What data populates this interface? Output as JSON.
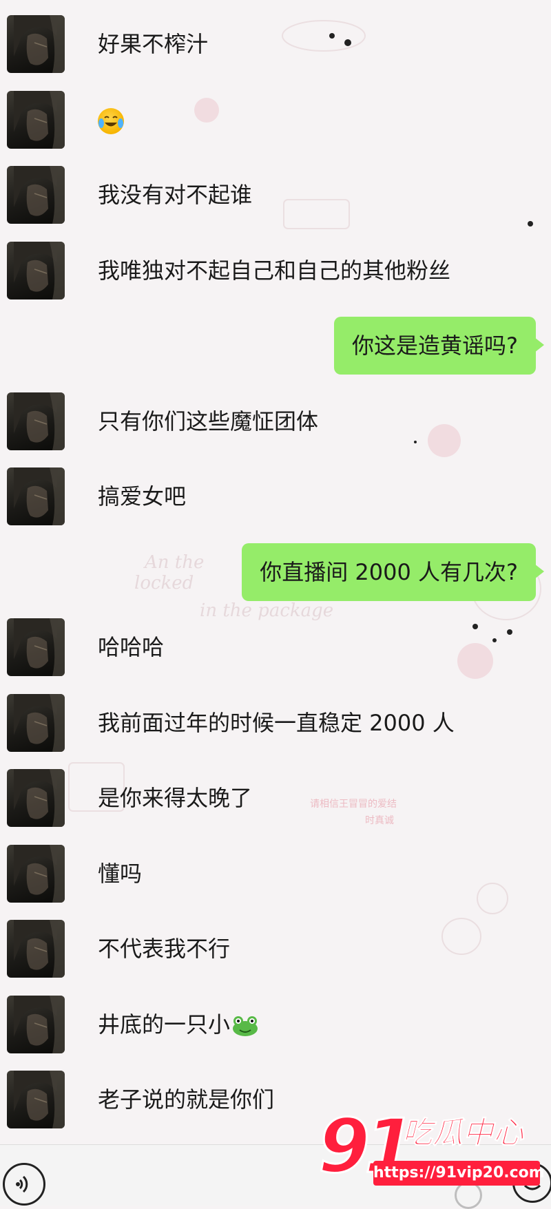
{
  "messages": [
    {
      "side": "in",
      "text": "好果不榨汁"
    },
    {
      "side": "in",
      "text": "",
      "icon": "laughing-crying-emoji-icon"
    },
    {
      "side": "in",
      "text": "我没有对不起谁"
    },
    {
      "side": "in",
      "text": "我唯独对不起自己和自己的其他粉丝"
    },
    {
      "side": "out",
      "text": "你这是造黄谣吗?"
    },
    {
      "side": "in",
      "text": "只有你们这些魔怔团体"
    },
    {
      "side": "in",
      "text": "搞爱女吧"
    },
    {
      "side": "out",
      "text": "你直播间 2000 人有几次?"
    },
    {
      "side": "in",
      "text": "哈哈哈"
    },
    {
      "side": "in",
      "text": "我前面过年的时候一直稳定 2000 人"
    },
    {
      "side": "in",
      "text": "是你来得太晚了"
    },
    {
      "side": "in",
      "text": "懂吗"
    },
    {
      "side": "in",
      "text": "不代表我不行"
    },
    {
      "side": "in",
      "text": "井底的一只小",
      "icon": "frog-emoji-icon"
    },
    {
      "side": "in",
      "text": "老子说的就是你们"
    }
  ],
  "bottom_bar": {
    "left_icon": "voice-input-icon",
    "right_icon": "emoji-button-icon"
  },
  "watermark": {
    "logo": "91",
    "title": "吃瓜中心",
    "url": "https://91vip20.com",
    "color": "#ff1f3d"
  },
  "colors": {
    "outgoing_bubble": "#95ec69",
    "background": "#f6f3f4"
  }
}
